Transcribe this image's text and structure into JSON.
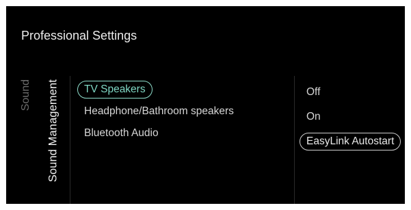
{
  "header": {
    "title": "Professional Settings"
  },
  "breadcrumb": {
    "parent": "Sound",
    "current": "Sound Management"
  },
  "menu": {
    "items": [
      {
        "label": "TV Speakers",
        "selected": true
      },
      {
        "label": "Headphone/Bathroom speakers",
        "selected": false
      },
      {
        "label": "Bluetooth Audio",
        "selected": false
      }
    ]
  },
  "options": {
    "items": [
      {
        "label": "Off",
        "selected": false
      },
      {
        "label": "On",
        "selected": false
      },
      {
        "label": "EasyLink Autostart",
        "selected": true
      }
    ]
  },
  "colors": {
    "background": "#000000",
    "focus_accent": "#8fdfcd",
    "text_primary": "#ededed",
    "text_dim": "#6c6c6c"
  }
}
